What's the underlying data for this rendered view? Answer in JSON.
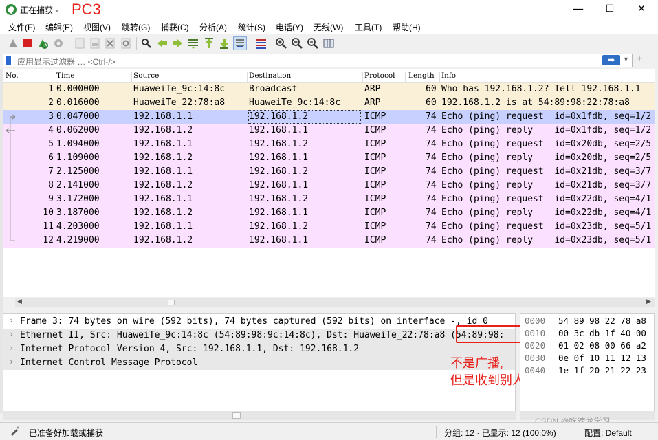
{
  "window": {
    "title": "正在捕获 -",
    "annotation": "PC3",
    "minimize": "—",
    "maximize": "☐",
    "close": "✕"
  },
  "menu": [
    "文件(F)",
    "编辑(E)",
    "视图(V)",
    "跳转(G)",
    "捕获(C)",
    "分析(A)",
    "统计(S)",
    "电话(Y)",
    "无线(W)",
    "工具(T)",
    "帮助(H)"
  ],
  "filter": {
    "placeholder": "应用显示过滤器 … <Ctrl-/>",
    "apply_label": "➡",
    "dropdown": "▼",
    "add_label": "+"
  },
  "packet_list": {
    "columns": [
      "No.",
      "Time",
      "Source",
      "Destination",
      "Protocol",
      "Length",
      "Info"
    ],
    "rows": [
      {
        "no": "1",
        "time": "0.000000",
        "src": "HuaweiTe_9c:14:8c",
        "dst": "Broadcast",
        "proto": "ARP",
        "len": "60",
        "info": "Who has 192.168.1.2? Tell 192.168.1.1"
      },
      {
        "no": "2",
        "time": "0.016000",
        "src": "HuaweiTe_22:78:a8",
        "dst": "HuaweiTe_9c:14:8c",
        "proto": "ARP",
        "len": "60",
        "info": "192.168.1.2 is at 54:89:98:22:78:a8"
      },
      {
        "no": "3",
        "time": "0.047000",
        "src": "192.168.1.1",
        "dst": "192.168.1.2",
        "proto": "ICMP",
        "len": "74",
        "info": "Echo (ping) request  id=0x1fdb, seq=1/2"
      },
      {
        "no": "4",
        "time": "0.062000",
        "src": "192.168.1.2",
        "dst": "192.168.1.1",
        "proto": "ICMP",
        "len": "74",
        "info": "Echo (ping) reply    id=0x1fdb, seq=1/2"
      },
      {
        "no": "5",
        "time": "1.094000",
        "src": "192.168.1.1",
        "dst": "192.168.1.2",
        "proto": "ICMP",
        "len": "74",
        "info": "Echo (ping) request  id=0x20db, seq=2/5"
      },
      {
        "no": "6",
        "time": "1.109000",
        "src": "192.168.1.2",
        "dst": "192.168.1.1",
        "proto": "ICMP",
        "len": "74",
        "info": "Echo (ping) reply    id=0x20db, seq=2/5"
      },
      {
        "no": "7",
        "time": "2.125000",
        "src": "192.168.1.1",
        "dst": "192.168.1.2",
        "proto": "ICMP",
        "len": "74",
        "info": "Echo (ping) request  id=0x21db, seq=3/7"
      },
      {
        "no": "8",
        "time": "2.141000",
        "src": "192.168.1.2",
        "dst": "192.168.1.1",
        "proto": "ICMP",
        "len": "74",
        "info": "Echo (ping) reply    id=0x21db, seq=3/7"
      },
      {
        "no": "9",
        "time": "3.172000",
        "src": "192.168.1.1",
        "dst": "192.168.1.2",
        "proto": "ICMP",
        "len": "74",
        "info": "Echo (ping) request  id=0x22db, seq=4/1"
      },
      {
        "no": "10",
        "time": "3.187000",
        "src": "192.168.1.2",
        "dst": "192.168.1.1",
        "proto": "ICMP",
        "len": "74",
        "info": "Echo (ping) reply    id=0x22db, seq=4/1"
      },
      {
        "no": "11",
        "time": "4.203000",
        "src": "192.168.1.1",
        "dst": "192.168.1.2",
        "proto": "ICMP",
        "len": "74",
        "info": "Echo (ping) request  id=0x23db, seq=5/1"
      },
      {
        "no": "12",
        "time": "4.219000",
        "src": "192.168.1.2",
        "dst": "192.168.1.1",
        "proto": "ICMP",
        "len": "74",
        "info": "Echo (ping) reply    id=0x23db, seq=5/1"
      }
    ]
  },
  "details": [
    "Frame 3: 74 bytes on wire (592 bits), 74 bytes captured (592 bits) on interface -, id 0",
    "Ethernet II, Src: HuaweiTe_9c:14:8c (54:89:98:9c:14:8c), Dst: HuaweiTe_22:78:a8 (54:89:98:",
    "Internet Protocol Version 4, Src: 192.168.1.1, Dst: 192.168.1.2",
    "Internet Control Message Protocol"
  ],
  "annotation_note": [
    "不是广播,",
    "但是收到别人的消息"
  ],
  "bytes": [
    {
      "off": "0000",
      "hex": "54 89 98 22 78 a8"
    },
    {
      "off": "0010",
      "hex": "00 3c db 1f 40 00"
    },
    {
      "off": "0020",
      "hex": "01 02 08 00 66 a2"
    },
    {
      "off": "0030",
      "hex": "0e 0f 10 11 12 13"
    },
    {
      "off": "0040",
      "hex": "1e 1f 20 21 22 23"
    }
  ],
  "watermark": "CSDN @吃速龙学习",
  "status": {
    "ready": "已准备好加载或捕获",
    "packets": "分组: 12 · 已显示: 12 (100.0%)",
    "profile": "配置: Default"
  },
  "colors": {
    "arp_row": "#faf0d7",
    "icmp_row": "#fce0ff",
    "selected_row": "#c8d0ff",
    "annotation": "#e8201a"
  }
}
